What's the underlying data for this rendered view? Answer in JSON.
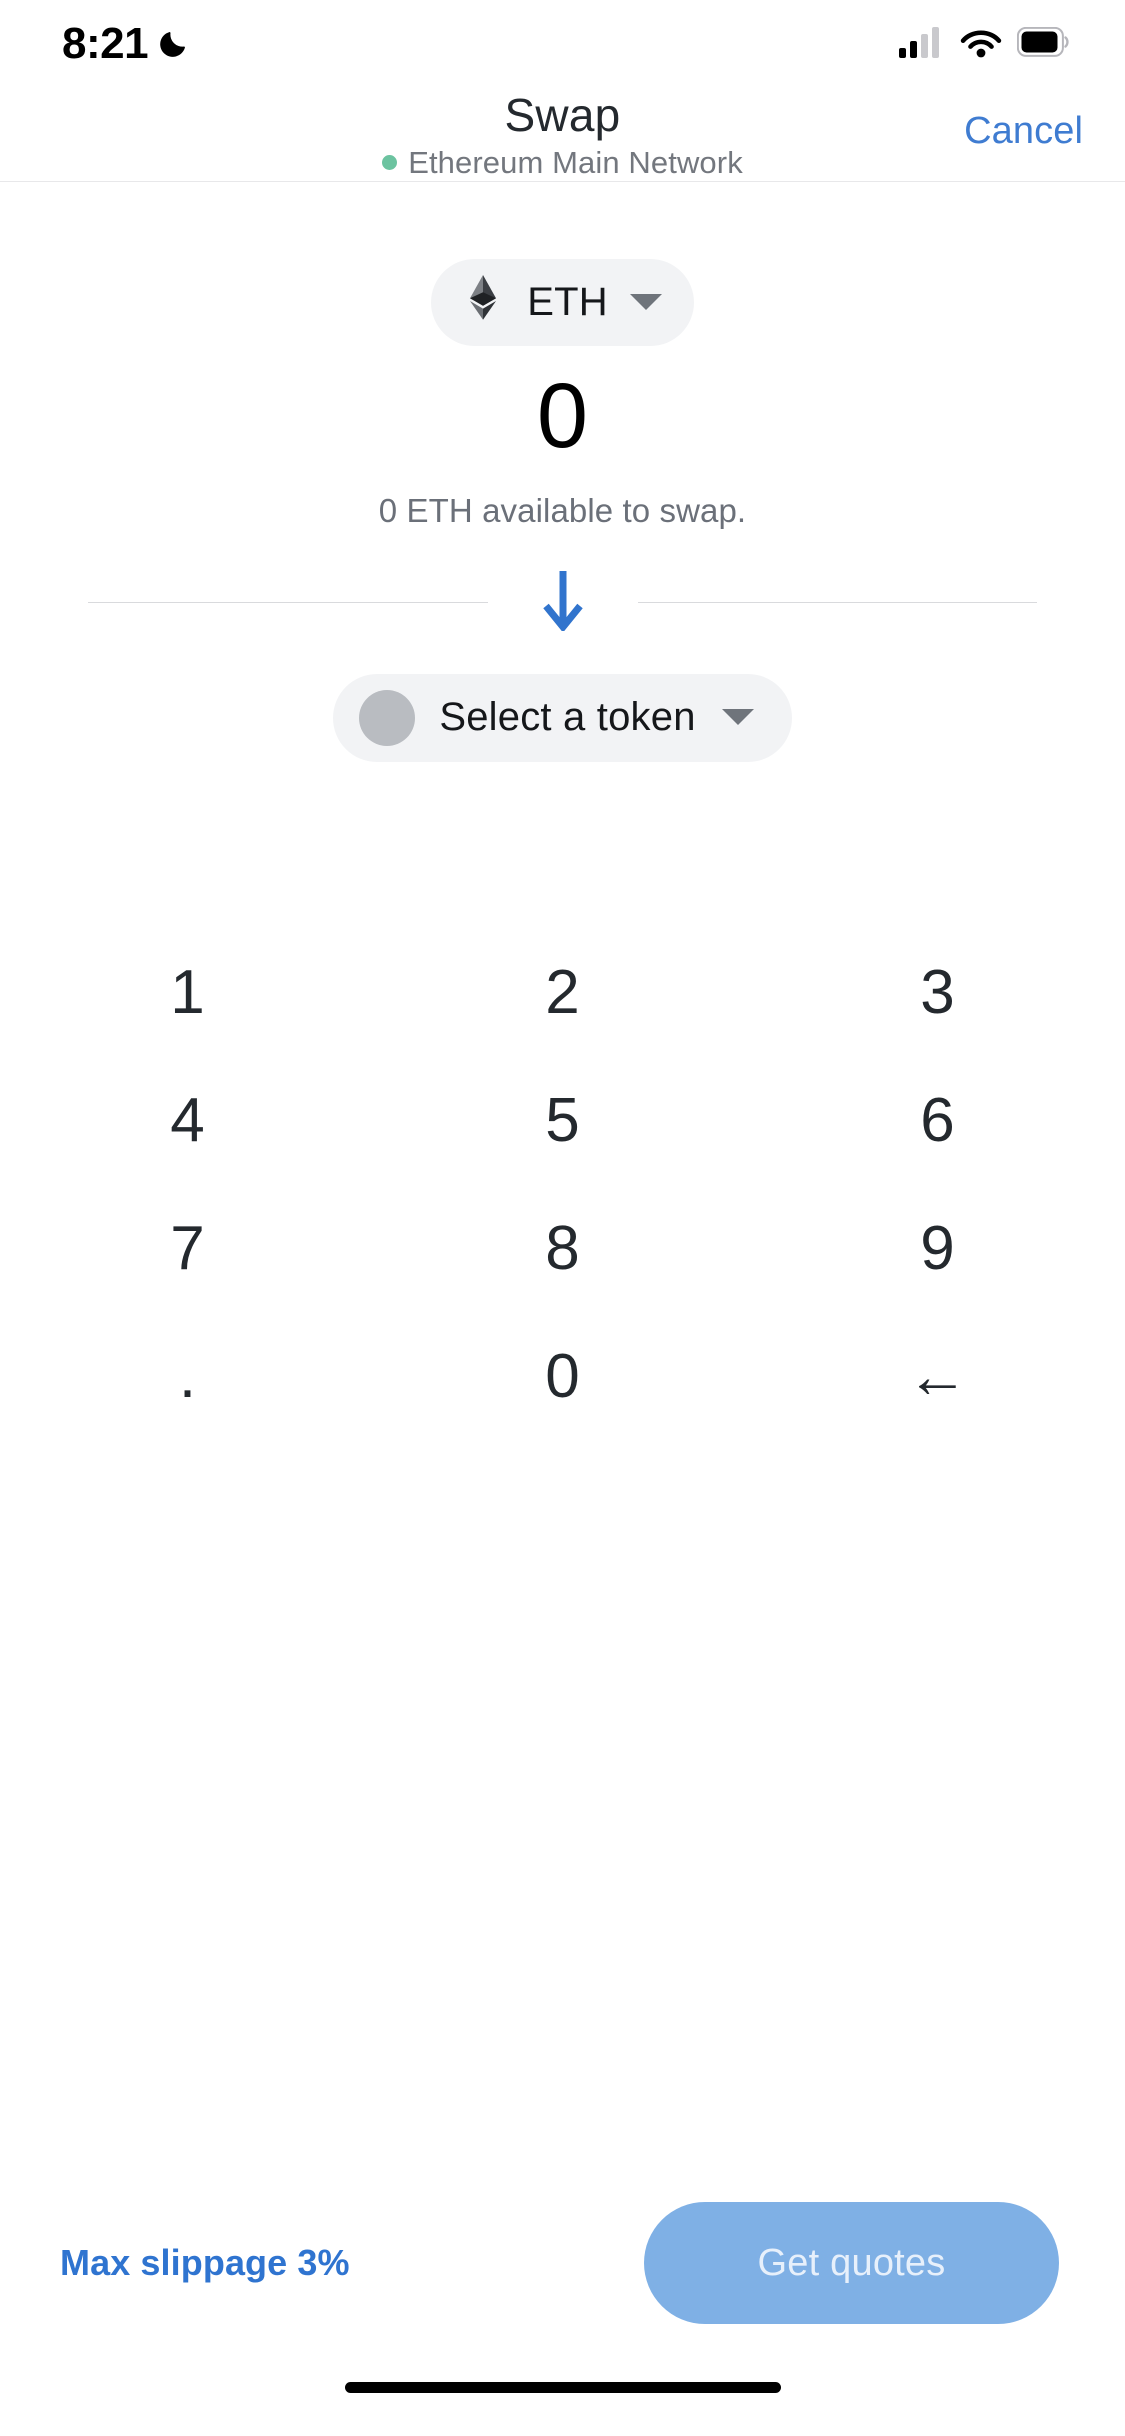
{
  "status_bar": {
    "time": "8:21",
    "dnd_icon": "crescent-moon-icon",
    "signal_icon": "cellular-signal-icon",
    "wifi_icon": "wifi-icon",
    "battery_icon": "battery-icon"
  },
  "header": {
    "title": "Swap",
    "network_name": "Ethereum Main Network",
    "network_dot_color": "#6cc3a0",
    "cancel_label": "Cancel",
    "cancel_color": "#3f7cd1"
  },
  "swap_form": {
    "source": {
      "token_symbol": "ETH",
      "token_icon": "ethereum-logo-icon",
      "dropdown_icon": "chevron-down-icon",
      "amount": "0",
      "available_text": "0 ETH available to swap."
    },
    "swap_direction_icon": "arrow-down-icon",
    "swap_direction_color": "#3174cd",
    "destination": {
      "label": "Select a token",
      "token_icon": "token-placeholder-icon",
      "dropdown_icon": "chevron-down-icon"
    }
  },
  "keypad": {
    "keys": [
      {
        "label": "1",
        "name": "key-1"
      },
      {
        "label": "2",
        "name": "key-2"
      },
      {
        "label": "3",
        "name": "key-3"
      },
      {
        "label": "4",
        "name": "key-4"
      },
      {
        "label": "5",
        "name": "key-5"
      },
      {
        "label": "6",
        "name": "key-6"
      },
      {
        "label": "7",
        "name": "key-7"
      },
      {
        "label": "8",
        "name": "key-8"
      },
      {
        "label": "9",
        "name": "key-9"
      },
      {
        "label": ".",
        "name": "key-decimal"
      },
      {
        "label": "0",
        "name": "key-0"
      },
      {
        "label": "←",
        "name": "key-backspace"
      }
    ]
  },
  "bottom_bar": {
    "slippage_label": "Max slippage 3%",
    "slippage_color": "#2f74d0",
    "get_quotes_label": "Get quotes",
    "get_quotes_bg": "#7fb0e5",
    "get_quotes_text_color": "#e7f0fb"
  }
}
